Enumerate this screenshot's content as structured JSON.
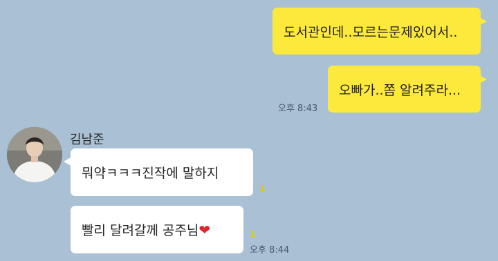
{
  "chat": {
    "messages_out": [
      {
        "text": "도서관인데..모르는문제있어서.."
      },
      {
        "text": "오빠가..쫌 알려주라..."
      }
    ],
    "out_time": "오후 8:43",
    "contact": {
      "name": "김남준",
      "avatar": "avatar"
    },
    "messages_in": [
      {
        "text": "뭐약ㅋㅋㅋ진작에 말하지",
        "unread": "1"
      },
      {
        "text": "빨리 달려갈께 공주님",
        "emoji": "❤",
        "unread": "1"
      }
    ],
    "in_time": "오후 8:44",
    "colors": {
      "background": "#a9c0d5",
      "my_bubble": "#fde93b",
      "their_bubble": "#ffffff",
      "unread": "#e8c600",
      "heart": "#e0262c"
    }
  }
}
